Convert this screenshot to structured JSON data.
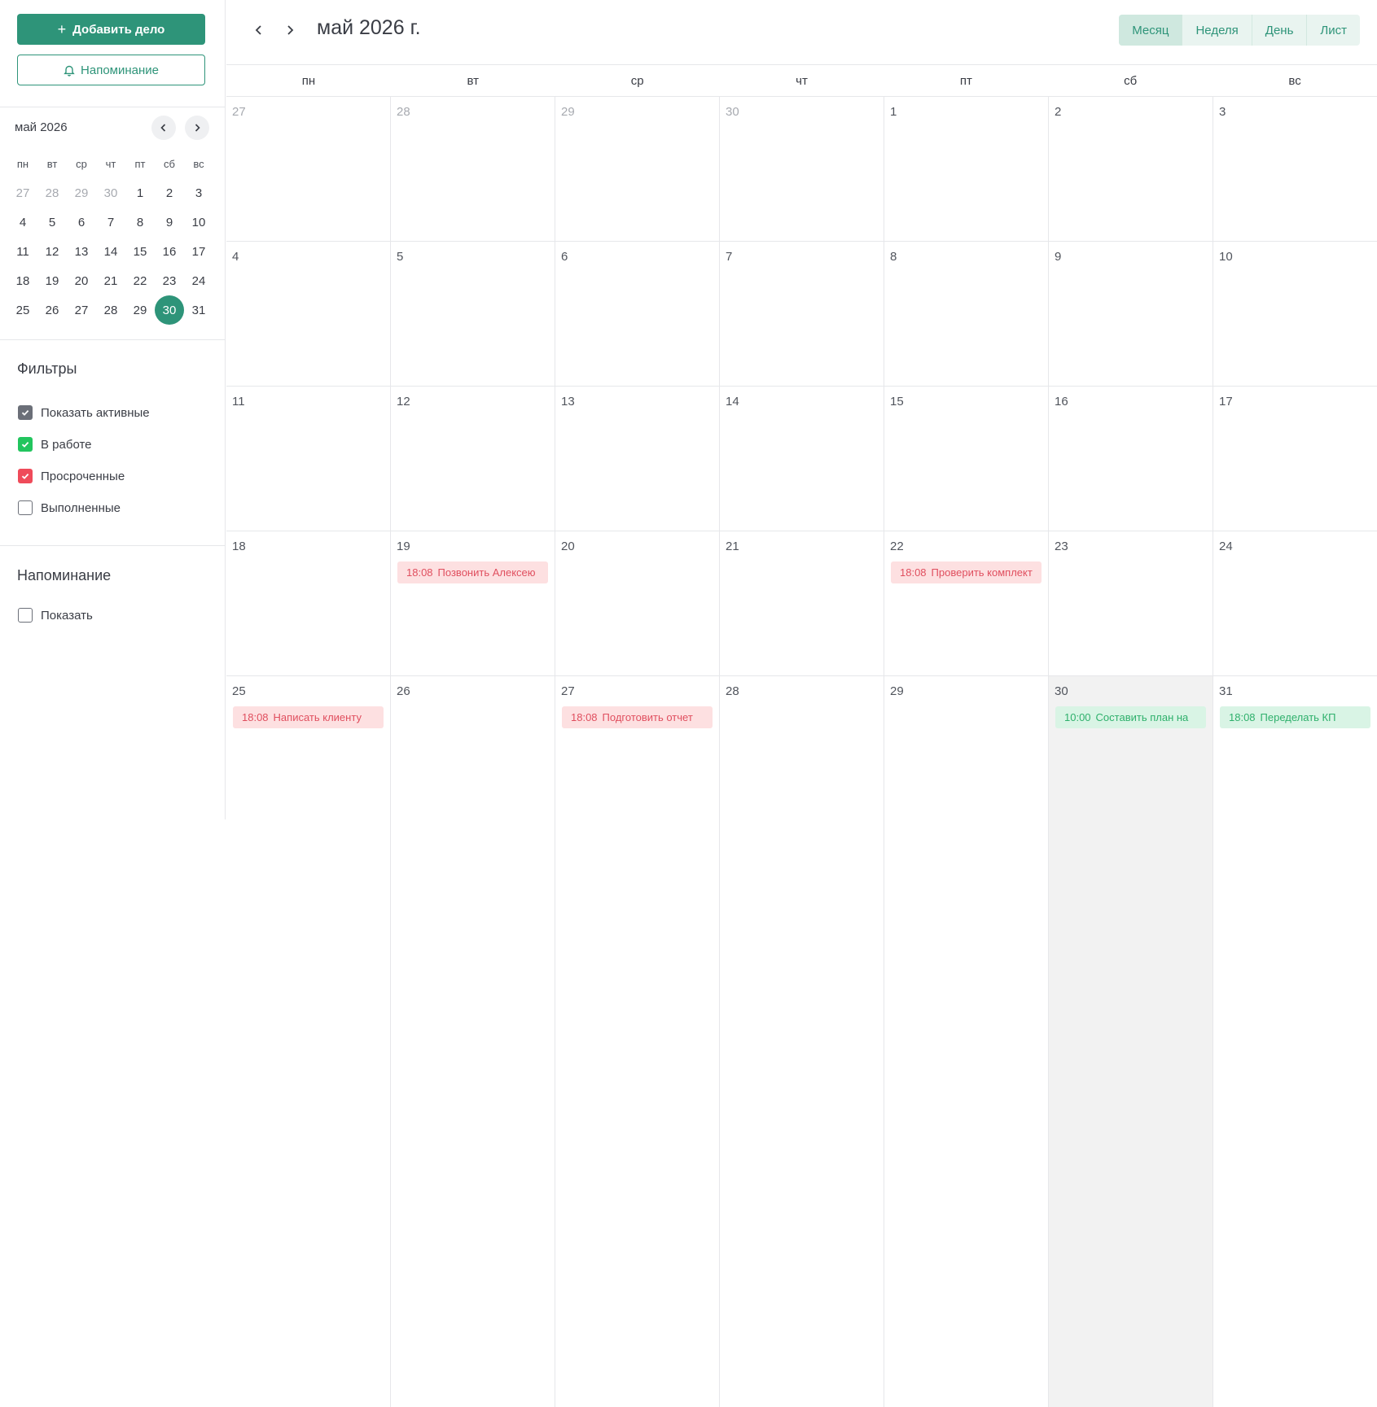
{
  "sidebar": {
    "add_button": "Добавить дело",
    "reminder_button": "Напоминание",
    "mini_calendar": {
      "title": "май 2026",
      "weekdays": [
        "пн",
        "вт",
        "ср",
        "чт",
        "пт",
        "сб",
        "вс"
      ],
      "weeks": [
        [
          "27",
          "28",
          "29",
          "30",
          "1",
          "2",
          "3"
        ],
        [
          "4",
          "5",
          "6",
          "7",
          "8",
          "9",
          "10"
        ],
        [
          "11",
          "12",
          "13",
          "14",
          "15",
          "16",
          "17"
        ],
        [
          "18",
          "19",
          "20",
          "21",
          "22",
          "23",
          "24"
        ],
        [
          "25",
          "26",
          "27",
          "28",
          "29",
          "30",
          "31"
        ]
      ],
      "selected_day": "30"
    },
    "filters": {
      "title": "Фильтры",
      "items": [
        {
          "label": "Показать активные",
          "checked": true,
          "color": "#6b6f78"
        },
        {
          "label": "В работе",
          "checked": true,
          "color": "#22c55e"
        },
        {
          "label": "Просроченные",
          "checked": true,
          "color": "#ef4b5a"
        },
        {
          "label": "Выполненные",
          "checked": false,
          "color": "#6b6f78"
        }
      ]
    },
    "reminder": {
      "title": "Напоминание",
      "show_label": "Показать",
      "checked": false
    }
  },
  "header": {
    "title": "май 2026 г.",
    "views": [
      "Месяц",
      "Неделя",
      "День",
      "Лист"
    ],
    "active_view": "Месяц"
  },
  "calendar": {
    "weekdays": [
      "пн",
      "вт",
      "ср",
      "чт",
      "пт",
      "сб",
      "вс"
    ],
    "weeks": [
      [
        {
          "day": "27",
          "muted": true
        },
        {
          "day": "28",
          "muted": true
        },
        {
          "day": "29",
          "muted": true
        },
        {
          "day": "30",
          "muted": true
        },
        {
          "day": "1"
        },
        {
          "day": "2"
        },
        {
          "day": "3"
        }
      ],
      [
        {
          "day": "4"
        },
        {
          "day": "5"
        },
        {
          "day": "6"
        },
        {
          "day": "7"
        },
        {
          "day": "8"
        },
        {
          "day": "9"
        },
        {
          "day": "10"
        }
      ],
      [
        {
          "day": "11"
        },
        {
          "day": "12"
        },
        {
          "day": "13"
        },
        {
          "day": "14"
        },
        {
          "day": "15"
        },
        {
          "day": "16"
        },
        {
          "day": "17"
        }
      ],
      [
        {
          "day": "18"
        },
        {
          "day": "19",
          "event": {
            "time": "18:08",
            "title": "Позвонить Алексею",
            "status": "red"
          }
        },
        {
          "day": "20"
        },
        {
          "day": "21"
        },
        {
          "day": "22",
          "event": {
            "time": "18:08",
            "title": "Проверить комплект",
            "status": "red"
          }
        },
        {
          "day": "23"
        },
        {
          "day": "24"
        }
      ],
      [
        {
          "day": "25",
          "event": {
            "time": "18:08",
            "title": "Написать клиенту",
            "status": "red"
          }
        },
        {
          "day": "26"
        },
        {
          "day": "27",
          "event": {
            "time": "18:08",
            "title": "Подготовить отчет",
            "status": "red"
          }
        },
        {
          "day": "28"
        },
        {
          "day": "29"
        },
        {
          "day": "30",
          "today": true,
          "event": {
            "time": "10:00",
            "title": "Составить план на",
            "status": "green"
          }
        },
        {
          "day": "31",
          "event": {
            "time": "18:08",
            "title": "Переделать КП",
            "status": "green"
          }
        }
      ]
    ]
  }
}
